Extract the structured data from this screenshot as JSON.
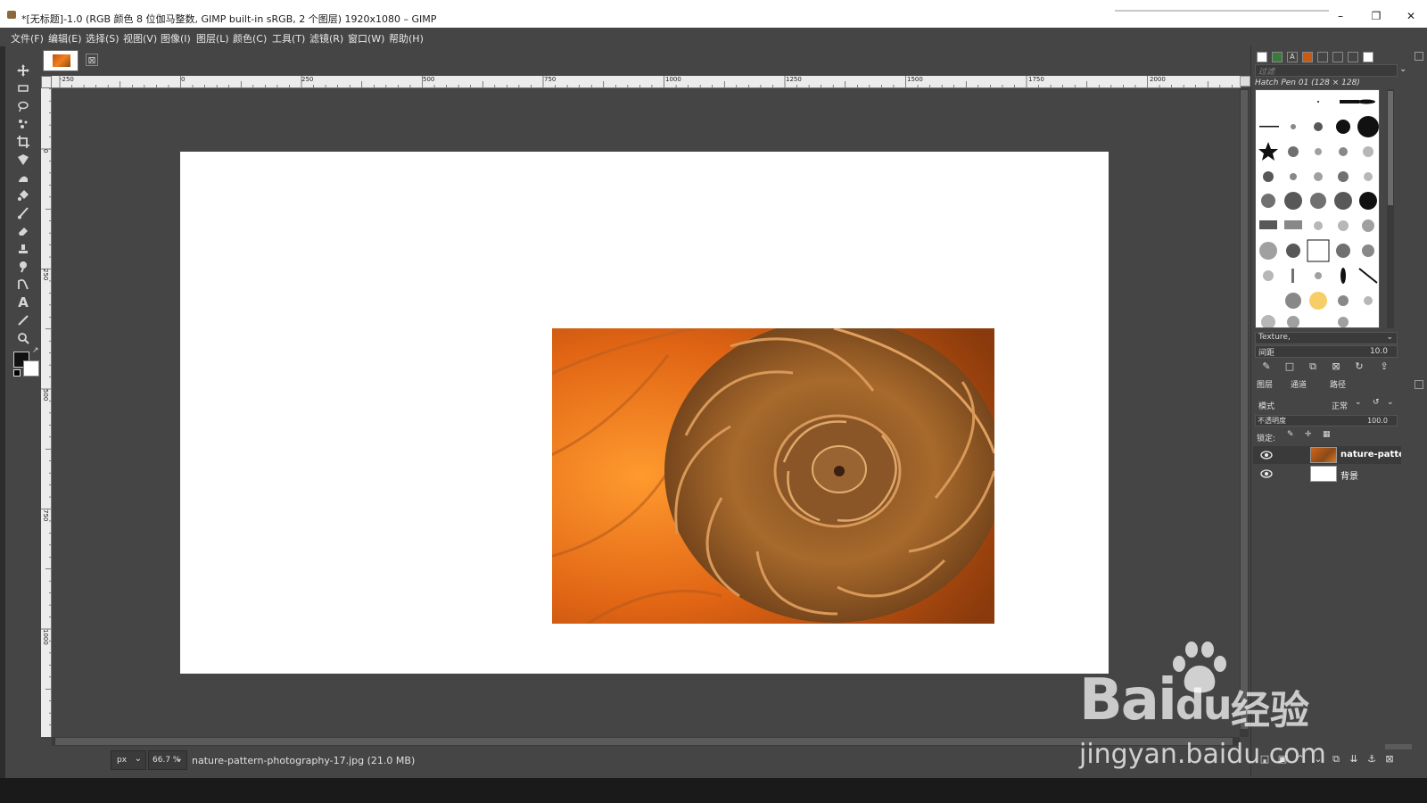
{
  "window": {
    "title": "*[无标题]-1.0 (RGB 颜色 8 位伽马整数, GIMP built-in sRGB, 2 个图层) 1920x1080 – GIMP",
    "minimize": "–",
    "maximize": "❐",
    "close": "✕"
  },
  "menu": {
    "items": [
      "文件(F)",
      "编辑(E)",
      "选择(S)",
      "视图(V)",
      "图像(I)",
      "图层(L)",
      "颜色(C)",
      "工具(T)",
      "滤镜(R)",
      "窗口(W)",
      "帮助(H)"
    ]
  },
  "toolbox": {
    "tools": [
      "move-tool-icon",
      "rect-select-icon",
      "lasso-icon",
      "fuzzy-select-icon",
      "crop-icon",
      "transform-icon",
      "warp-icon",
      "fill-icon",
      "paintbrush-icon",
      "eraser-icon",
      "clone-icon",
      "smudge-icon",
      "paths-icon",
      "text-icon",
      "color-picker-icon",
      "zoom-icon"
    ],
    "text_tool_label": "A",
    "swap_label": "↗"
  },
  "canvas": {
    "tab_close": "⊠",
    "hruler_labels": [
      "-250",
      "0",
      "250",
      "500",
      "750",
      "1000",
      "1250",
      "1500",
      "1750",
      "2000"
    ],
    "vruler_labels": [
      "0",
      "250",
      "500",
      "750",
      "1000"
    ]
  },
  "status": {
    "unit": "px",
    "zoom": "66.7 %",
    "file": "nature-pattern-photography-17.jpg (21.0 MB)"
  },
  "brushes": {
    "filter_placeholder": "过滤",
    "current": "Hatch Pen 01 (128 × 128)",
    "tag": "Texture,",
    "spacing_label": "间距",
    "spacing_value": "10.0"
  },
  "layers": {
    "tabs": [
      "图层",
      "通道",
      "路径"
    ],
    "mode_label": "模式",
    "mode_value": "正常",
    "opacity_label": "不透明度",
    "opacity_value": "100.0",
    "lock_label": "锁定:",
    "items": [
      {
        "name": "nature-patter",
        "thumb_color": "#c8621c"
      },
      {
        "name": "背景",
        "thumb_color": "#ffffff"
      }
    ]
  },
  "watermark": {
    "brand": "Bai",
    "brand2": "du",
    "cn": "经验",
    "url": "jingyan.baidu.com"
  },
  "colors": {
    "canvas_bg": "#454545",
    "page_bg": "#ffffff",
    "accent_orange": "#e8741a"
  }
}
